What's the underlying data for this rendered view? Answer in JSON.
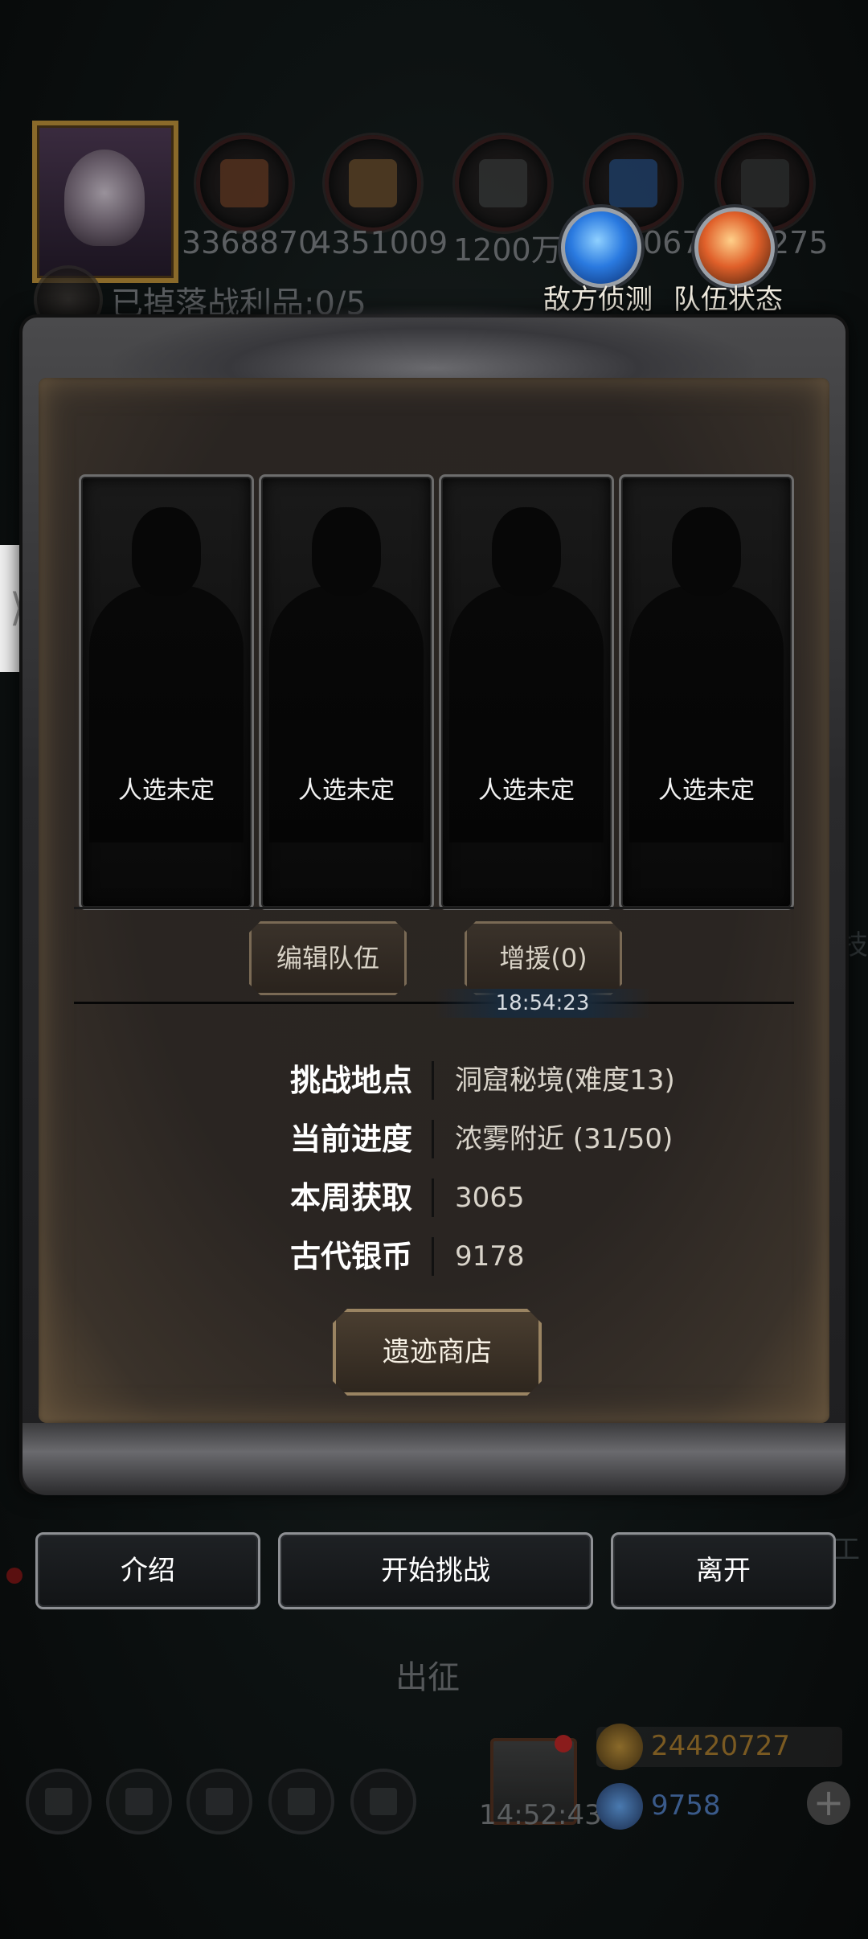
{
  "top_bar": {
    "resources": [
      {
        "icon": "meat-icon",
        "value": "3368870",
        "color": "#a0522d"
      },
      {
        "icon": "wood-icon",
        "value": "4351009",
        "color": "#b07a3a"
      },
      {
        "icon": "iron-icon",
        "value": "1200万",
        "color": "#666666"
      },
      {
        "icon": "crystal-icon",
        "value": "067",
        "color": "#3a7ad0"
      },
      {
        "icon": "stone-icon",
        "value": "275",
        "color": "#5a5a5a"
      }
    ],
    "loot_label": "已掉落战利品:0/5"
  },
  "quick_actions": {
    "enemy_scout": "敌方侦测",
    "team_status": "队伍状态"
  },
  "team": {
    "slots": [
      {
        "label": "人选未定"
      },
      {
        "label": "人选未定"
      },
      {
        "label": "人选未定"
      },
      {
        "label": "人选未定"
      }
    ],
    "edit_button": "编辑队伍",
    "reinforce_button": "增援(0)",
    "timer": "18:54:23"
  },
  "info": {
    "rows": [
      {
        "key": "挑战地点",
        "value": "洞窟秘境(难度13)"
      },
      {
        "key": "当前进度",
        "value": "浓雾附近 (31/50)"
      },
      {
        "key": "本周获取",
        "value": "3065"
      },
      {
        "key": "古代银币",
        "value": "9178"
      }
    ],
    "shop_button": "遗迹商店"
  },
  "actions": {
    "intro": "介绍",
    "start": "开始挑战",
    "leave": "离开"
  },
  "hud": {
    "expedition": "出征",
    "gift_timer": "14:52:43",
    "gold": "24420727",
    "gems": "9758",
    "gold_color": "#8a6a2a",
    "gem_color": "#3a5a8a"
  },
  "background_hints": {
    "right_1": "技",
    "right_2": "工"
  }
}
